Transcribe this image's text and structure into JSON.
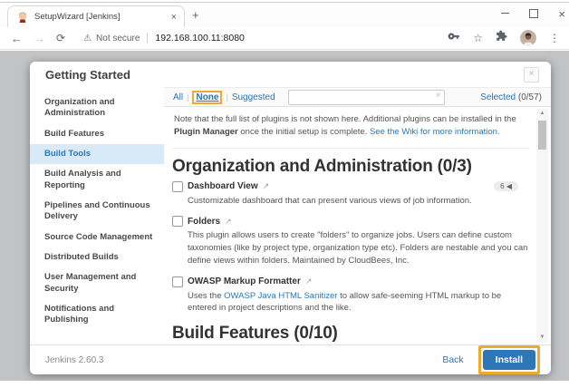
{
  "browser": {
    "tab_title": "SetupWizard [Jenkins]",
    "tab_close": "×",
    "new_tab_button": "+",
    "window_close": "×",
    "address": {
      "security": "Not secure",
      "url": "192.168.100.11:8080"
    },
    "glyphs": {
      "back": "←",
      "forward": "→",
      "reload": "⟳",
      "warning": "⚠",
      "star": "☆",
      "menu": "⋮"
    }
  },
  "dialog": {
    "title": "Getting Started",
    "close": "×",
    "sidebar": {
      "items": [
        "Organization and Administration",
        "Build Features",
        "Build Tools",
        "Build Analysis and Reporting",
        "Pipelines and Continuous Delivery",
        "Source Code Management",
        "Distributed Builds",
        "User Management and Security",
        "Notifications and Publishing"
      ],
      "selected": "Build Tools"
    },
    "filters": {
      "all": "All",
      "none": "None",
      "suggested": "Suggested",
      "separator": "|",
      "clear": "×",
      "selected_word": "Selected",
      "selected_count": "(0/57)"
    },
    "note": {
      "before": "Note that the full list of plugins is not shown here. Additional plugins can be installed in the ",
      "bold": "Plugin Manager",
      "middle": " once the initial setup is complete. ",
      "link": "See the Wiki for more information."
    },
    "sections": {
      "s1_heading": "Organization and Administration (0/3)",
      "s2_heading": "Build Features (0/10)"
    },
    "plugins": {
      "dashboard": {
        "name": "Dashboard View",
        "ext": "↗",
        "badge": "6 ◀",
        "desc": "Customizable dashboard that can present various views of job information."
      },
      "folders": {
        "name": "Folders",
        "ext": "↗",
        "desc": "This plugin allows users to create \"folders\" to organize jobs. Users can define custom taxonomies (like by project type, organization type etc). Folders are nestable and you can define views within folders. Maintained by CloudBees, Inc."
      },
      "owasp": {
        "name": "OWASP Markup Formatter",
        "ext": "↗",
        "desc_before": "Uses the ",
        "desc_link": "OWASP Java HTML Sanitizer",
        "desc_after": " to allow safe-seeming HTML markup to be entered in project descriptions and the like."
      }
    },
    "scrollbar": {
      "up": "▲",
      "down": "▼"
    },
    "footer": {
      "version": "Jenkins 2.60.3",
      "back": "Back",
      "install": "Install"
    }
  },
  "colors": {
    "accent_blue": "#2b77b8",
    "install_button": "#2d76b7",
    "annotation_highlight": "#F0A830",
    "sidebar_selected_bg": "#d8e9f7",
    "page_background": "#c2c3c5"
  }
}
